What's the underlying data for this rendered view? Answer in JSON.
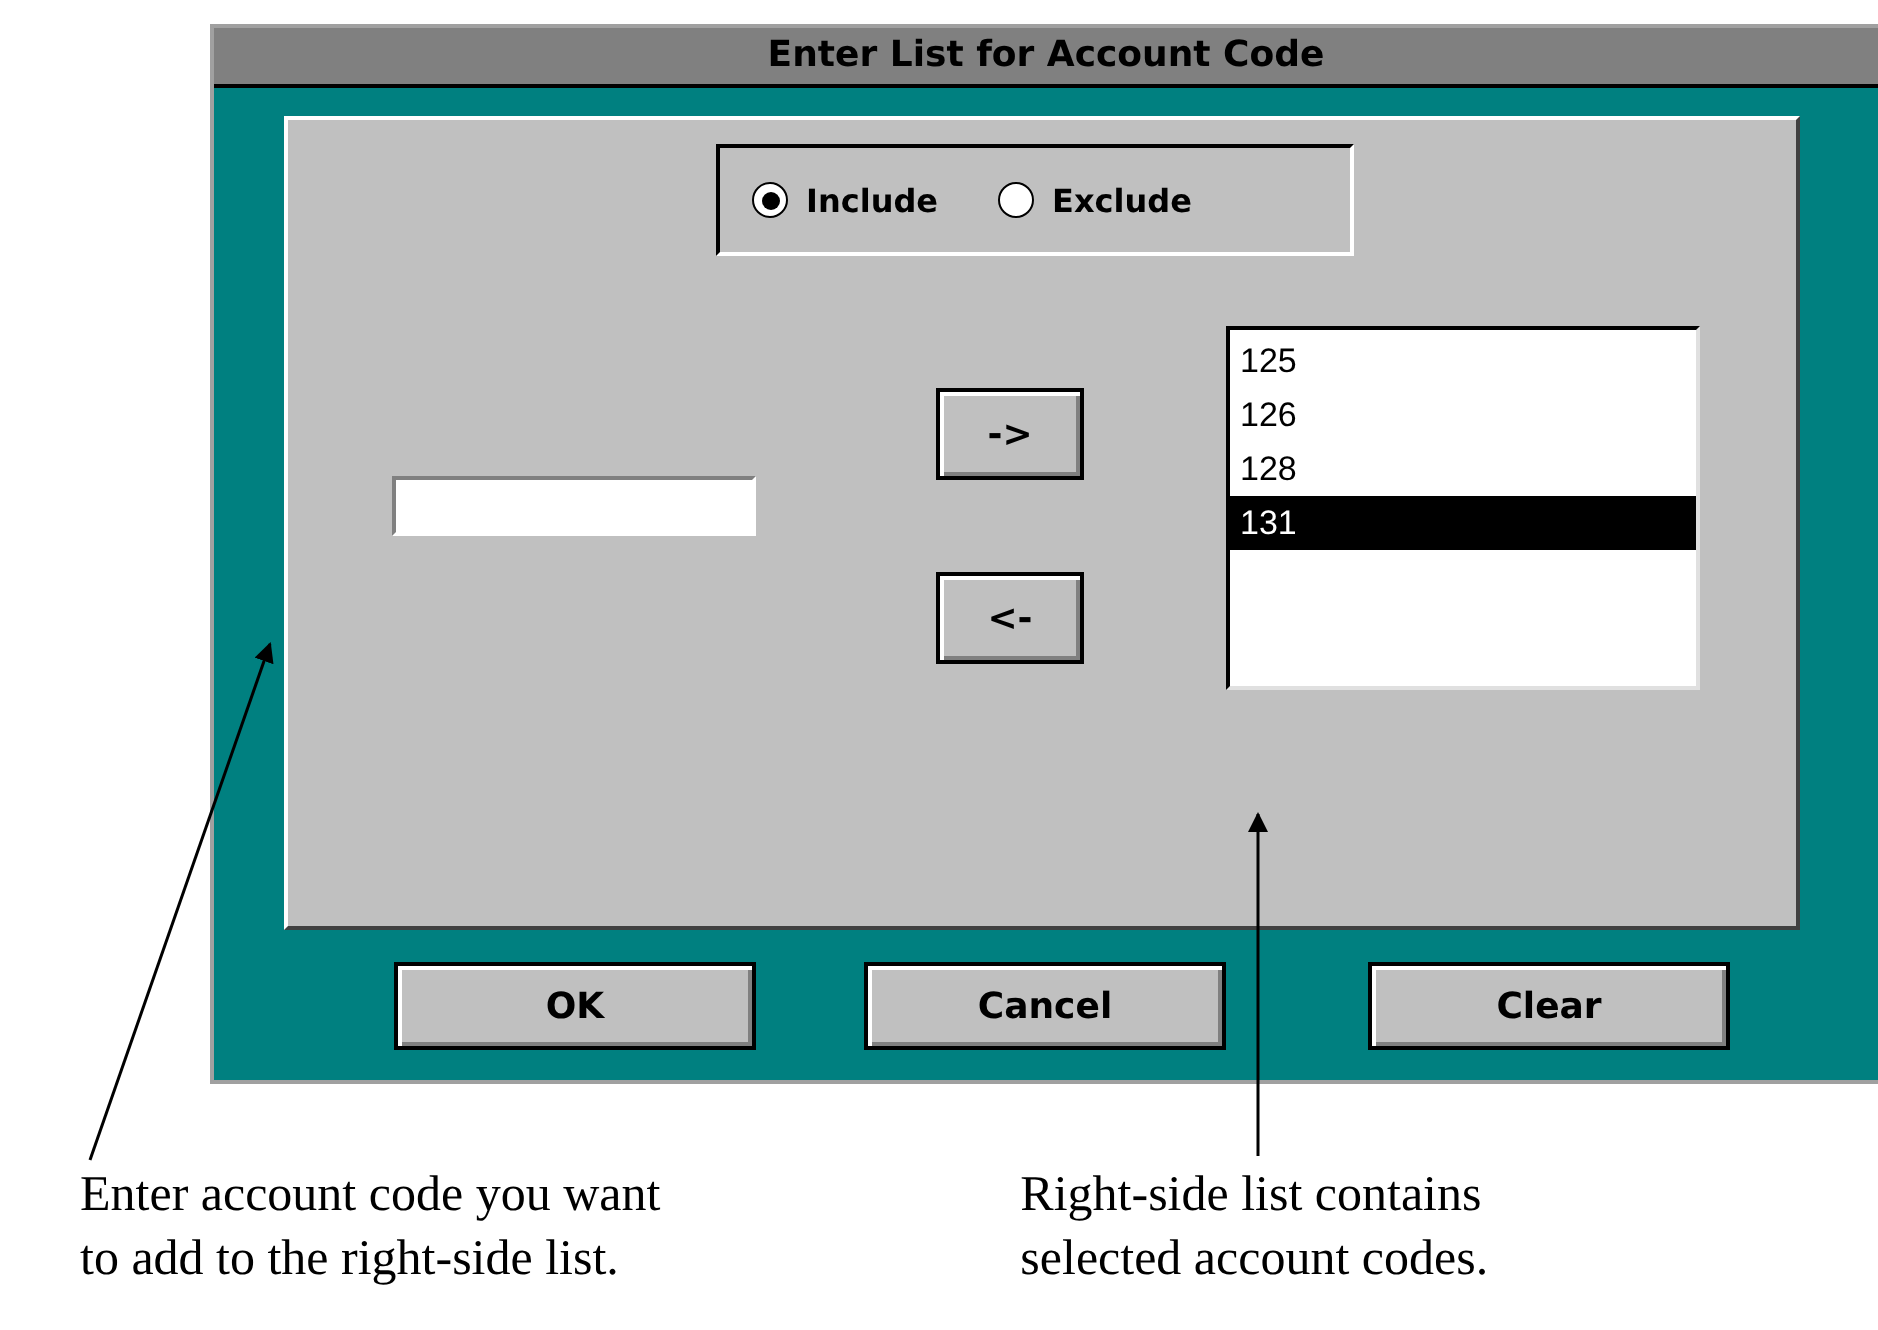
{
  "dialog": {
    "title": "Enter List for Account Code",
    "filter_options": [
      {
        "label": "Include",
        "selected": true
      },
      {
        "label": "Exclude",
        "selected": false
      }
    ],
    "arrow_buttons": [
      "->",
      "<-"
    ],
    "account_codes": [
      {
        "label": "125",
        "selected": false
      },
      {
        "label": "126",
        "selected": false
      },
      {
        "label": "128",
        "selected": false
      },
      {
        "label": "131",
        "selected": true
      }
    ],
    "buttons": [
      "OK",
      "Cancel",
      "Clear"
    ]
  },
  "annotations": [
    {
      "lines": [
        "Enter account code you want",
        "to add to the right-side list."
      ]
    },
    {
      "lines": [
        "Right-side list contains",
        "selected account codes."
      ]
    }
  ]
}
